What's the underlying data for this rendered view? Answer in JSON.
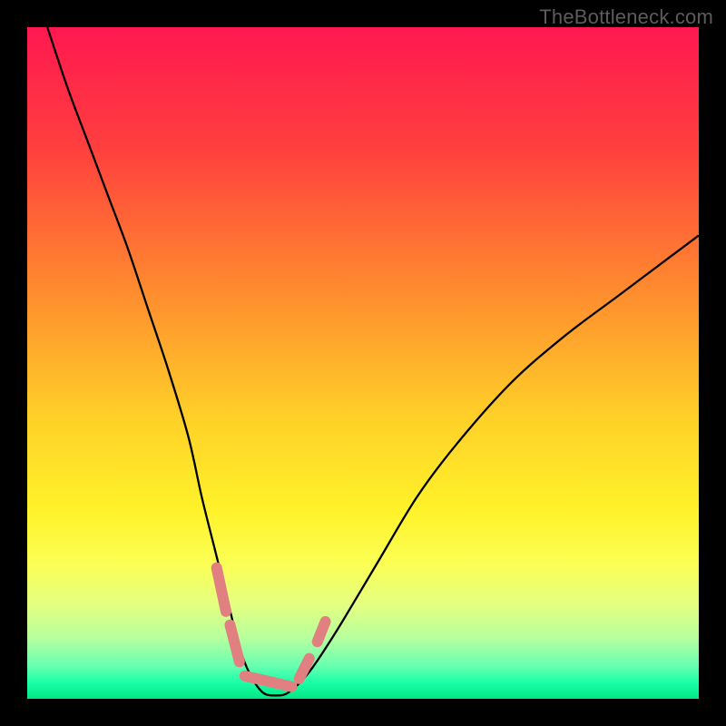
{
  "watermark": {
    "text": "TheBottleneck.com"
  },
  "chart_data": {
    "type": "line",
    "title": "",
    "xlabel": "",
    "ylabel": "",
    "xlim": [
      0,
      100
    ],
    "ylim": [
      0,
      100
    ],
    "grid": false,
    "legend": false,
    "background_gradient_stops": [
      {
        "offset": 0.0,
        "color": "#ff1850"
      },
      {
        "offset": 0.18,
        "color": "#ff3f3e"
      },
      {
        "offset": 0.4,
        "color": "#ff8e2e"
      },
      {
        "offset": 0.58,
        "color": "#ffd028"
      },
      {
        "offset": 0.72,
        "color": "#fff22a"
      },
      {
        "offset": 0.8,
        "color": "#fbff55"
      },
      {
        "offset": 0.86,
        "color": "#e4ff80"
      },
      {
        "offset": 0.91,
        "color": "#b6ff9e"
      },
      {
        "offset": 0.95,
        "color": "#6affb0"
      },
      {
        "offset": 0.975,
        "color": "#1effa8"
      },
      {
        "offset": 1.0,
        "color": "#00e884"
      }
    ],
    "series": [
      {
        "name": "bottleneck-curve",
        "color": "#000000",
        "stroke_width": 2.3,
        "x": [
          3,
          6,
          9,
          12,
          15,
          18,
          21,
          24,
          26,
          28,
          30,
          31.5,
          33,
          35,
          37,
          39,
          42,
          46,
          52,
          58,
          64,
          72,
          80,
          88,
          96,
          100
        ],
        "y": [
          100,
          91,
          83,
          75,
          67,
          58,
          49,
          39,
          30,
          22,
          14,
          8,
          4,
          1,
          0.5,
          1,
          4,
          10,
          20,
          30,
          38,
          47,
          54,
          60,
          66,
          69
        ]
      },
      {
        "name": "marker-overlay",
        "color": "#e08080",
        "stroke_width": 12,
        "linecap": "round",
        "segments": [
          {
            "x": [
              28.2,
              29.6
            ],
            "y": [
              19.5,
              13.0
            ]
          },
          {
            "x": [
              30.2,
              31.6
            ],
            "y": [
              11.0,
              5.5
            ]
          },
          {
            "x": [
              32.4,
              39.4
            ],
            "y": [
              3.4,
              1.8
            ]
          },
          {
            "x": [
              40.5,
              42.0
            ],
            "y": [
              3.0,
              6.0
            ]
          },
          {
            "x": [
              43.2,
              44.4
            ],
            "y": [
              8.5,
              11.5
            ]
          }
        ]
      }
    ]
  }
}
